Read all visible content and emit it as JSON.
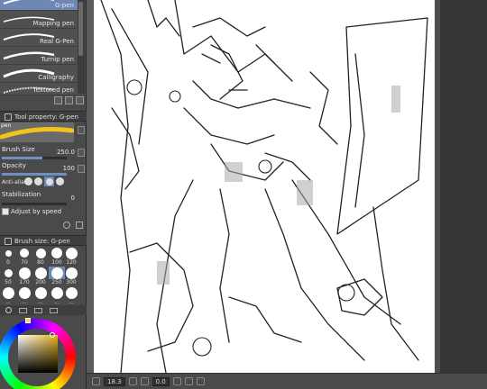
{
  "brushes": [
    {
      "label": "G-pen",
      "selected": true
    },
    {
      "label": "Mapping pen",
      "selected": false
    },
    {
      "label": "Real G-Pen",
      "selected": false
    },
    {
      "label": "Turnip pen",
      "selected": false
    },
    {
      "label": "Calligraphy",
      "selected": false
    },
    {
      "label": "Textured pen",
      "selected": false
    }
  ],
  "tool_property": {
    "header": "Tool property: G-pen",
    "preview_label": "pen",
    "brush_size_label": "Brush Size",
    "brush_size_value": "250.0",
    "opacity_label": "Opacity",
    "opacity_value": "100",
    "anti_alias_label": "Anti-alias",
    "stabilization_label": "Stabilization",
    "stabilization_value": "0",
    "adjust_speed_label": "Adjust by speed"
  },
  "brush_size_panel": {
    "header": "Brush size: G-pen",
    "sizes": [
      "0",
      "70",
      "80",
      "100",
      "120",
      "50",
      "170",
      "200",
      "250",
      "300",
      "...",
      "...",
      "...",
      "...",
      "..."
    ],
    "selected": "250"
  },
  "status": {
    "zoom": "18.3",
    "rotation": "0.0"
  },
  "colors": {
    "selection": "#6e88b6",
    "panel": "#4a4a4a"
  }
}
